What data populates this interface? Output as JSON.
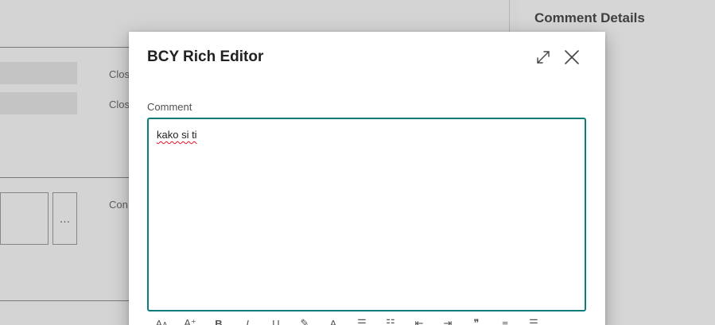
{
  "background": {
    "labels": [
      "Clos",
      "Clos",
      "Con"
    ],
    "more_button_label": "…"
  },
  "side_panel": {
    "title": "Comment Details"
  },
  "modal": {
    "title": "BCY Rich Editor",
    "field_label": "Comment",
    "editor_text": "kako si ti",
    "toolbar": [
      {
        "name": "font-size-icon",
        "glyph": "Aᴀ"
      },
      {
        "name": "font-grow-icon",
        "glyph": "A⁺"
      },
      {
        "name": "bold-icon",
        "glyph": "B"
      },
      {
        "name": "italic-icon",
        "glyph": "I"
      },
      {
        "name": "underline-icon",
        "glyph": "U"
      },
      {
        "name": "highlight-icon",
        "glyph": "✎"
      },
      {
        "name": "font-color-icon",
        "glyph": "A"
      },
      {
        "name": "bullet-list-icon",
        "glyph": "☰"
      },
      {
        "name": "numbered-list-icon",
        "glyph": "☷"
      },
      {
        "name": "outdent-icon",
        "glyph": "⇤"
      },
      {
        "name": "indent-icon",
        "glyph": "⇥"
      },
      {
        "name": "quote-icon",
        "glyph": "❞"
      },
      {
        "name": "align-left-icon",
        "glyph": "≡"
      },
      {
        "name": "align-center-icon",
        "glyph": "☰"
      },
      {
        "name": "more-options-icon",
        "glyph": "…"
      }
    ]
  },
  "colors": {
    "accent": "#0f7c7c",
    "spellcheck": "#e81123"
  }
}
